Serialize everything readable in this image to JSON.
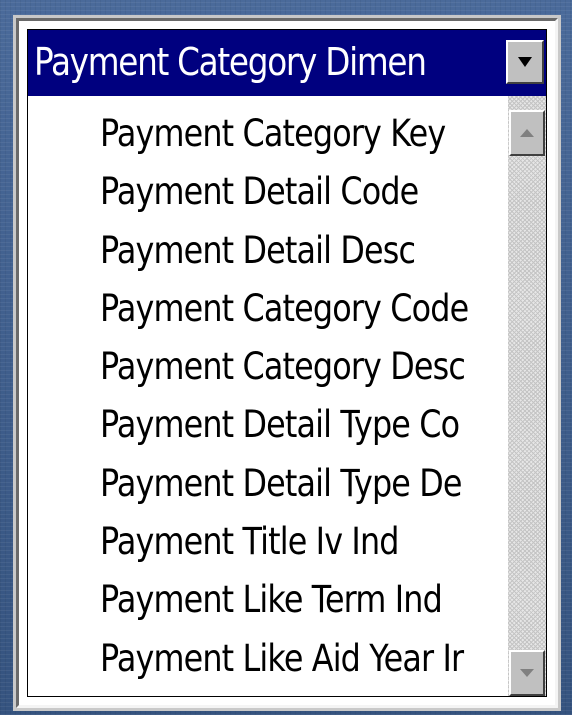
{
  "dimension_list": {
    "title": "Payment Category Dimen",
    "items": [
      {
        "label": "Payment Category Key"
      },
      {
        "label": "Payment Detail Code"
      },
      {
        "label": "Payment Detail Desc"
      },
      {
        "label": "Payment Category Code"
      },
      {
        "label": "Payment Category Desc"
      },
      {
        "label": "Payment Detail Type Co"
      },
      {
        "label": "Payment Detail Type De"
      },
      {
        "label": "Payment Title Iv Ind"
      },
      {
        "label": "Payment Like Term Ind"
      },
      {
        "label": "Payment Like Aid Year Ir"
      }
    ]
  },
  "icons": {
    "dropdown": "chevron-down-icon",
    "scroll_up": "scroll-up-arrow-icon",
    "scroll_down": "scroll-down-arrow-icon"
  },
  "colors": {
    "title_bar": "#00007f",
    "title_text": "#ffffff",
    "scroll_button": "#c0c0c0",
    "background": "#3f5f8e"
  }
}
